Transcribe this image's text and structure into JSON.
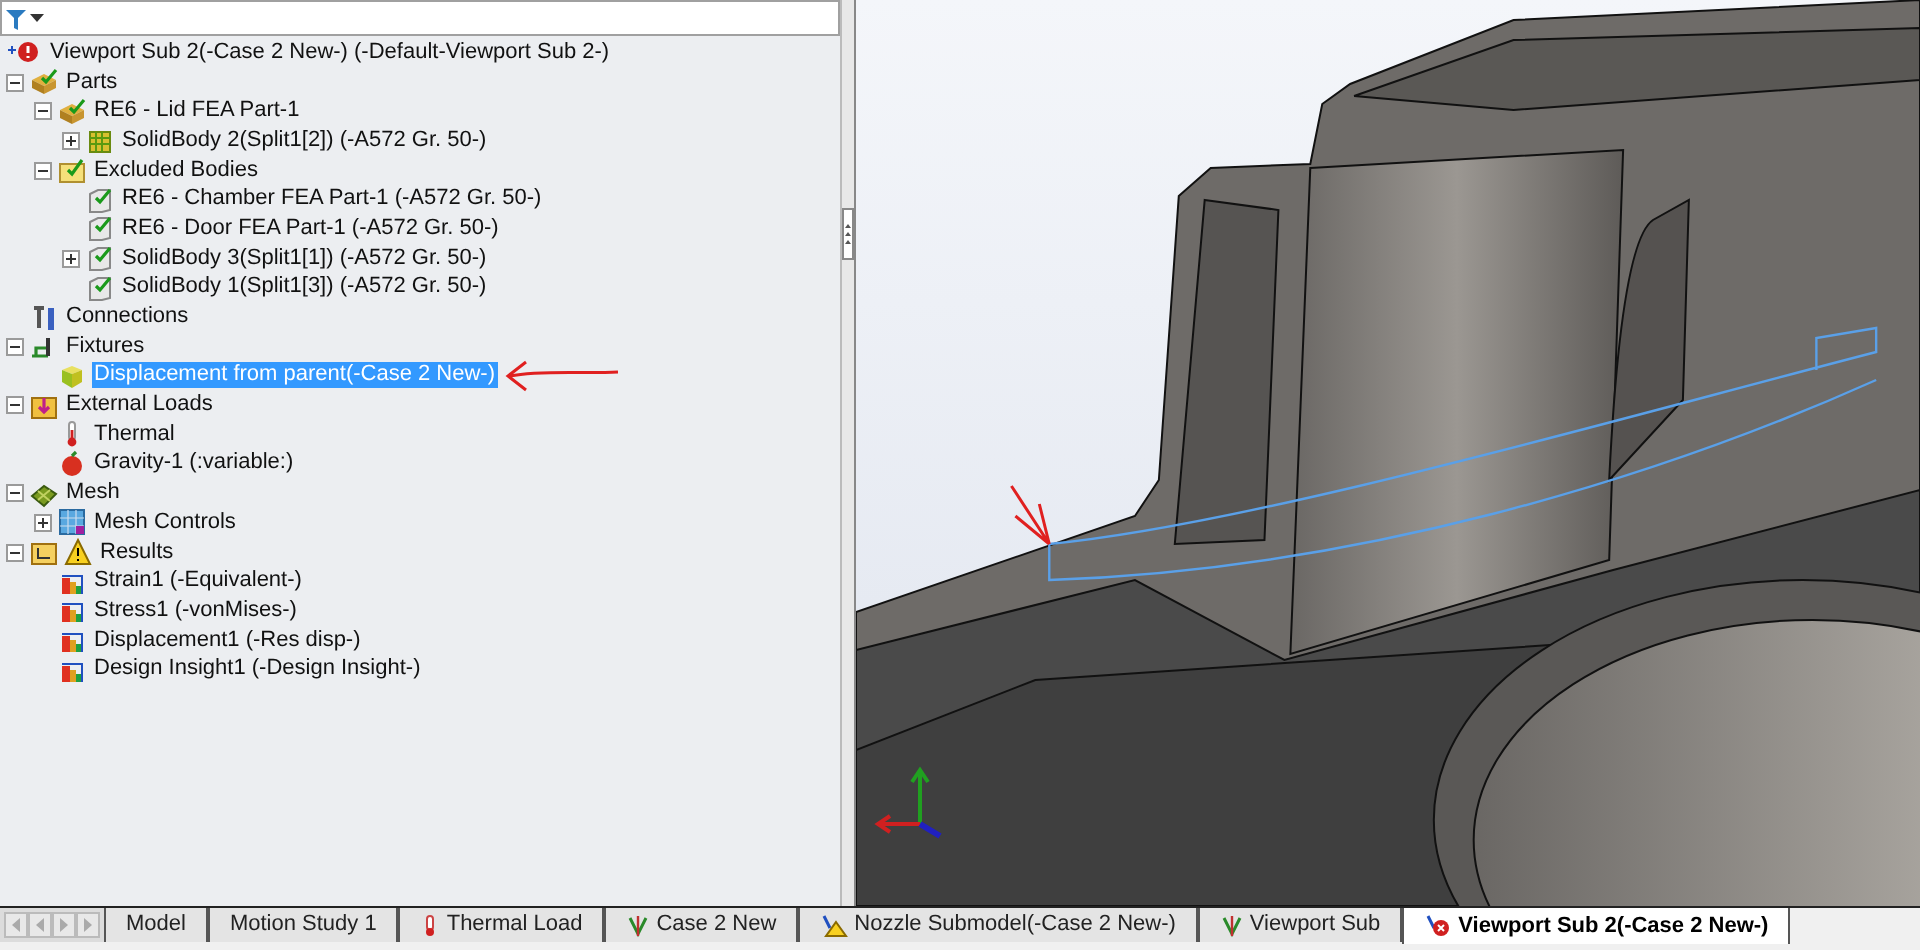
{
  "tree": {
    "root": {
      "label": "Viewport Sub 2(-Case 2 New-) (-Default-Viewport Sub 2-)",
      "selected": false
    },
    "items": [
      {
        "label": "Parts",
        "kind": "parts",
        "selected": false,
        "expanded": true,
        "children": [
          {
            "label": "RE6 - Lid FEA Part-1",
            "kind": "part",
            "selected": false,
            "expanded": true,
            "children": [
              {
                "label": "SolidBody 2(Split1[2]) (-A572 Gr. 50-)",
                "kind": "body",
                "selected": false,
                "expanded": false
              }
            ]
          },
          {
            "label": "Excluded Bodies",
            "kind": "folder",
            "selected": false,
            "expanded": true,
            "children": [
              {
                "label": "RE6 - Chamber FEA Part-1 (-A572 Gr. 50-)",
                "kind": "excluded",
                "selected": false
              },
              {
                "label": "RE6 - Door FEA Part-1 (-A572 Gr. 50-)",
                "kind": "excluded",
                "selected": false
              },
              {
                "label": "SolidBody 3(Split1[1]) (-A572 Gr. 50-)",
                "kind": "excluded",
                "selected": false,
                "expanded": false
              },
              {
                "label": "SolidBody 1(Split1[3]) (-A572 Gr. 50-)",
                "kind": "excluded",
                "selected": false
              }
            ]
          }
        ]
      },
      {
        "label": "Connections",
        "kind": "connections",
        "selected": false
      },
      {
        "label": "Fixtures",
        "kind": "fixtures",
        "selected": false,
        "expanded": true,
        "children": [
          {
            "label": "Displacement from parent(-Case 2 New-)",
            "kind": "fixture",
            "selected": true
          }
        ]
      },
      {
        "label": "External Loads",
        "kind": "loads",
        "selected": false,
        "expanded": true,
        "children": [
          {
            "label": "Thermal",
            "kind": "thermal",
            "selected": false
          },
          {
            "label": "Gravity-1 (:variable:)",
            "kind": "gravity",
            "selected": false
          }
        ]
      },
      {
        "label": "Mesh",
        "kind": "mesh",
        "selected": false,
        "expanded": true,
        "children": [
          {
            "label": "Mesh Controls",
            "kind": "meshcontrols",
            "selected": false,
            "expanded": false
          }
        ]
      },
      {
        "label": "Results",
        "kind": "results",
        "selected": false,
        "expanded": true,
        "children": [
          {
            "label": "Strain1 (-Equivalent-)",
            "kind": "plot",
            "selected": false
          },
          {
            "label": "Stress1 (-vonMises-)",
            "kind": "plot",
            "selected": false
          },
          {
            "label": "Displacement1 (-Res disp-)",
            "kind": "plot",
            "selected": false
          },
          {
            "label": "Design Insight1 (-Design Insight-)",
            "kind": "plot",
            "selected": false
          }
        ]
      }
    ]
  },
  "tabs": [
    {
      "label": "Model",
      "kind": "plain",
      "selected": false
    },
    {
      "label": "Motion Study 1",
      "kind": "plain",
      "selected": false
    },
    {
      "label": "Thermal Load",
      "kind": "thermal",
      "selected": false
    },
    {
      "label": "Case 2 New",
      "kind": "study",
      "selected": false
    },
    {
      "label": "Nozzle Submodel(-Case 2 New-)",
      "kind": "warning",
      "selected": false
    },
    {
      "label": "Viewport Sub",
      "kind": "study",
      "selected": false
    },
    {
      "label": "Viewport Sub 2(-Case 2 New-)",
      "kind": "error",
      "selected": true
    }
  ]
}
